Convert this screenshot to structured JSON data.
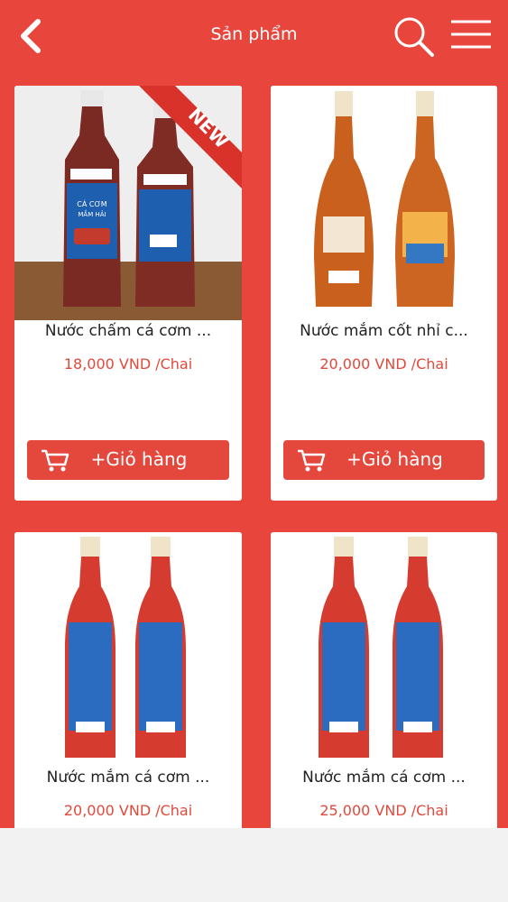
{
  "header": {
    "title": "Sản phẩm"
  },
  "products": [
    {
      "name": "Nước chấm cá cơm ...",
      "price": "18,000 VND /Chai",
      "cart_label": "+Giỏ hàng",
      "badge": "NEW",
      "label_line1": "CÁ CƠM",
      "label_line2": "MẮM HẢI"
    },
    {
      "name": "Nước mắm cốt nhỉ c...",
      "price": "20,000 VND /Chai",
      "cart_label": "+Giỏ hàng"
    },
    {
      "name": "Nước mắm cá cơm ...",
      "price": "20,000 VND /Chai"
    },
    {
      "name": "Nước mắm cá cơm ...",
      "price": "25,000 VND /Chai"
    }
  ],
  "colors": {
    "brand": "#e8463c",
    "price": "#e04a3c",
    "button": "#e4483c"
  },
  "icons": {
    "back": "chevron-left-icon",
    "search": "search-icon",
    "menu": "hamburger-menu-icon",
    "cart": "shopping-cart-icon"
  }
}
